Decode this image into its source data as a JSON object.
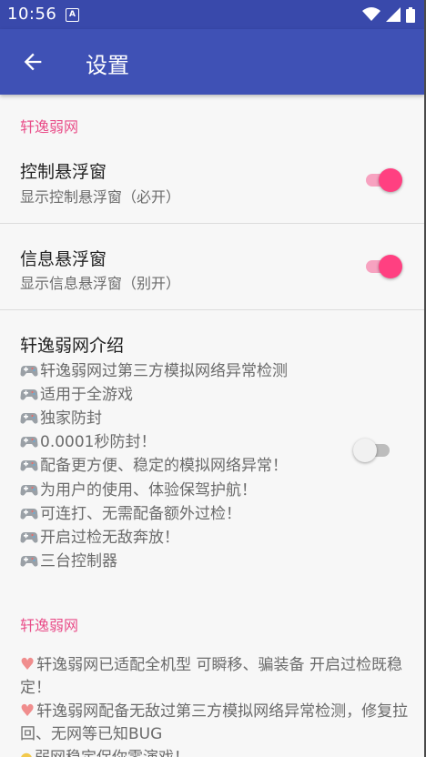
{
  "status_bar": {
    "time": "10:56"
  },
  "toolbar": {
    "title": "设置"
  },
  "section1": {
    "header": "轩逸弱网"
  },
  "pref_float_control": {
    "title": "控制悬浮窗",
    "summary": "显示控制悬浮窗（必开）",
    "enabled": true
  },
  "pref_float_info": {
    "title": "信息悬浮窗",
    "summary": "显示信息悬浮窗（别开）",
    "enabled": true
  },
  "pref_intro": {
    "title": "轩逸弱网介绍",
    "enabled": false,
    "lines": [
      "轩逸弱网过第三方模拟网络异常检测",
      "适用于全游戏",
      "独家防封",
      "0.0001秒防封！",
      "配备更方便、稳定的模拟网络异常！",
      "为用户的使用、体验保驾护航！",
      "可连打、无需配备额外过检！",
      "开启过检无敌奔放！",
      "三台控制器"
    ]
  },
  "section2": {
    "header": "轩逸弱网",
    "para1": "轩逸弱网已适配全机型 可瞬移、骗装备 开启过检既稳定！",
    "para2": "轩逸弱网配备无敌过第三方模拟网络异常检测，修复拉回、无网等已知BUG",
    "para3": "弱网稳定保你零演戏！"
  },
  "icons": {
    "back": "arrow-left-icon",
    "wifi": "wifi-icon",
    "signal": "signal-icon",
    "battery": "battery-icon",
    "notification": "text-notification-icon",
    "gamepad": "gamepad-icon",
    "heart": "heart-icon",
    "bulb": "lightbulb-icon"
  },
  "colors": {
    "primary": "#3f51b5",
    "status_bar": "#3949ab",
    "accent": "#ff4081",
    "section_header": "#e94e89"
  }
}
